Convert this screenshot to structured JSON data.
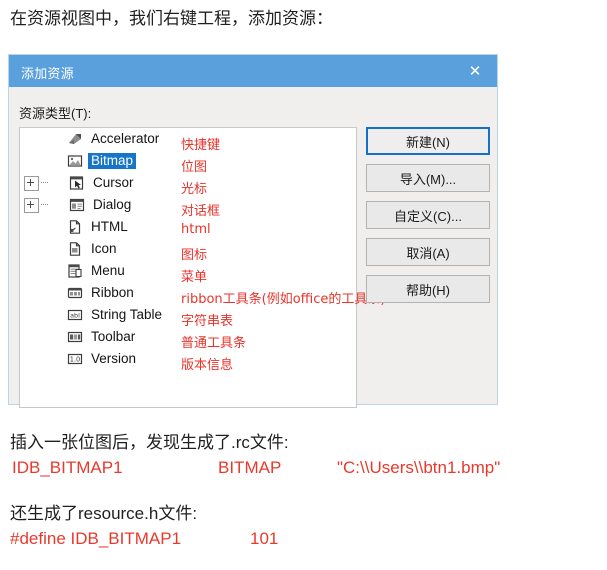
{
  "document": {
    "heading_top": "在资源视图中，我们右键工程，添加资源：",
    "section_rc": {
      "caption": "插入一张位图后，发现生成了.rc文件:",
      "id": "IDB_BITMAP1",
      "type": "BITMAP",
      "path": "\"C:\\\\Users\\\\btn1.bmp\""
    },
    "section_header": {
      "caption": "还生成了resource.h文件:",
      "define": "#define IDB_BITMAP1",
      "value": "101"
    }
  },
  "dialog": {
    "title": "添加资源",
    "close_glyph": "✕",
    "resource_type_label": "资源类型(T):",
    "title_bar_color": "#5aa0dd",
    "selection_color": "#1675c8",
    "annotation_color": "#e8332a",
    "tree": [
      {
        "label": "Accelerator",
        "icon": "accelerator-icon",
        "expandable": false,
        "selected": false,
        "annotation": "快捷键"
      },
      {
        "label": "Bitmap",
        "icon": "bitmap-icon",
        "expandable": false,
        "selected": true,
        "annotation": "位图"
      },
      {
        "label": "Cursor",
        "icon": "cursor-icon",
        "expandable": true,
        "selected": false,
        "annotation": "光标"
      },
      {
        "label": "Dialog",
        "icon": "dialog-icon",
        "expandable": true,
        "selected": false,
        "annotation": "对话框"
      },
      {
        "label": "HTML",
        "icon": "html-icon",
        "expandable": false,
        "selected": false,
        "annotation": "html"
      },
      {
        "label": "Icon",
        "icon": "icon-file-icon",
        "expandable": false,
        "selected": false,
        "annotation": "图标"
      },
      {
        "label": "Menu",
        "icon": "menu-icon",
        "expandable": false,
        "selected": false,
        "annotation": "菜单"
      },
      {
        "label": "Ribbon",
        "icon": "ribbon-icon",
        "expandable": false,
        "selected": false,
        "annotation": "ribbon工具条(例如office的工具条)"
      },
      {
        "label": "String Table",
        "icon": "string-table-icon",
        "expandable": false,
        "selected": false,
        "annotation": "字符串表"
      },
      {
        "label": "Toolbar",
        "icon": "toolbar-icon",
        "expandable": false,
        "selected": false,
        "annotation": "普通工具条"
      },
      {
        "label": "Version",
        "icon": "version-icon",
        "expandable": false,
        "selected": false,
        "annotation": "版本信息"
      }
    ],
    "buttons": [
      {
        "label": "新建(N)",
        "name": "new-button",
        "default": true
      },
      {
        "label": "导入(M)...",
        "name": "import-button",
        "default": false
      },
      {
        "label": "自定义(C)...",
        "name": "customize-button",
        "default": false
      },
      {
        "label": "取消(A)",
        "name": "cancel-button",
        "default": false
      },
      {
        "label": "帮助(H)",
        "name": "help-button",
        "default": false
      }
    ]
  }
}
